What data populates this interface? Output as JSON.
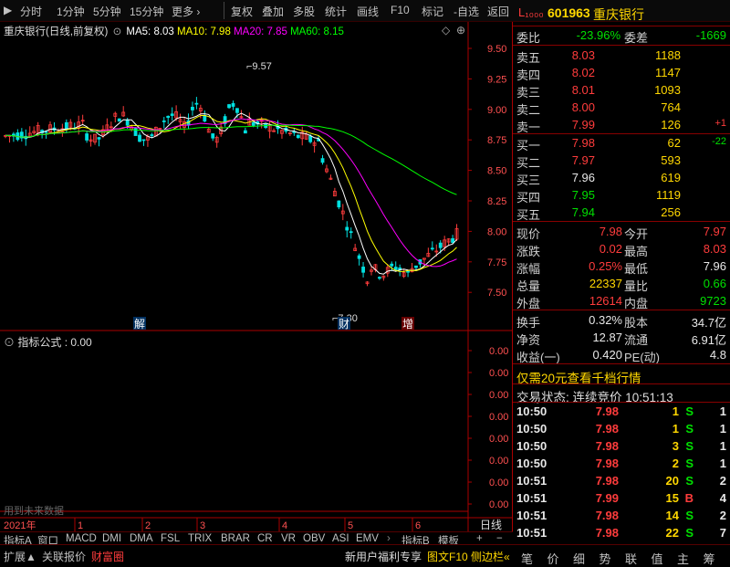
{
  "toolbar": {
    "left": [
      "分时",
      "1分钟",
      "5分钟",
      "15分钟",
      "更多"
    ],
    "right": [
      "复权",
      "叠加",
      "多股",
      "统计",
      "画线",
      "F10",
      "标记",
      "-自选",
      "返回"
    ]
  },
  "legend": {
    "title": "重庆银行(日线,前复权)",
    "ma5": "MA5: 8.03",
    "ma10": "MA10: 7.98",
    "ma20": "MA20: 7.85",
    "ma60": "MA60: 8.15"
  },
  "price_axis": [
    "9.50",
    "9.25",
    "9.00",
    "8.75",
    "8.50",
    "8.25",
    "8.00",
    "7.75",
    "7.50"
  ],
  "annotations": {
    "high": "9.57",
    "low": "7.30",
    "mark1": "解",
    "mark2": "财",
    "mark3": "增"
  },
  "indicator": {
    "title": "指标公式 : 0.00",
    "footer": "用到未来数据",
    "axis": [
      "0.00",
      "0.00",
      "0.00",
      "0.00",
      "0.00",
      "0.00",
      "0.00",
      "0.00"
    ]
  },
  "date_axis": {
    "year": "2021年",
    "months": [
      "1",
      "2",
      "3",
      "4",
      "5",
      "6"
    ],
    "corner": "日线"
  },
  "index_tabs": [
    "指标A",
    "窗口",
    "MACD",
    "DMI",
    "DMA",
    "FSL",
    "TRIX",
    "BRAR",
    "CR",
    "VR",
    "OBV",
    "ASI",
    "EMV"
  ],
  "index_tabs_right": [
    "指标B",
    "模板",
    "+",
    "−"
  ],
  "bottom_tabs": [
    "扩展",
    "关联报价",
    "财富圈"
  ],
  "bottom_right": [
    "新用户福利专享",
    "图文F10",
    "侧边栏"
  ],
  "bottom_mini": [
    "笔",
    "价",
    "细",
    "势",
    "联",
    "值",
    "主",
    "筹"
  ],
  "stock": {
    "code": "601963",
    "name": "重庆银行",
    "l2": "L₁₀₀₀"
  },
  "webi": {
    "l1": "委比",
    "v1": "-23.96%",
    "l2": "委差",
    "v2": "-1669"
  },
  "asks": [
    {
      "label": "卖五",
      "price": "8.03",
      "vol": "1188",
      "chg": ""
    },
    {
      "label": "卖四",
      "price": "8.02",
      "vol": "1147",
      "chg": ""
    },
    {
      "label": "卖三",
      "price": "8.01",
      "vol": "1093",
      "chg": ""
    },
    {
      "label": "卖二",
      "price": "8.00",
      "vol": "764",
      "chg": ""
    },
    {
      "label": "卖一",
      "price": "7.99",
      "vol": "126",
      "chg": "+1"
    }
  ],
  "bids": [
    {
      "label": "买一",
      "price": "7.98",
      "vol": "62",
      "chg": "-22"
    },
    {
      "label": "买二",
      "price": "7.97",
      "vol": "593",
      "chg": ""
    },
    {
      "label": "买三",
      "price": "7.96",
      "vol": "619",
      "chg": ""
    },
    {
      "label": "买四",
      "price": "7.95",
      "vol": "1119",
      "chg": ""
    },
    {
      "label": "买五",
      "price": "7.94",
      "vol": "256",
      "chg": ""
    }
  ],
  "stats": [
    {
      "l1": "现价",
      "v1": "7.98",
      "l2": "今开",
      "v2": "7.97"
    },
    {
      "l1": "涨跌",
      "v1": "0.02",
      "l2": "最高",
      "v2": "8.03"
    },
    {
      "l1": "涨幅",
      "v1": "0.25%",
      "l2": "最低",
      "v2": "7.96"
    },
    {
      "l1": "总量",
      "v1": "22337",
      "l2": "量比",
      "v2": "0.66"
    },
    {
      "l1": "外盘",
      "v1": "12614",
      "l2": "内盘",
      "v2": "9723"
    }
  ],
  "stats2": [
    {
      "l1": "换手",
      "v1": "0.32%",
      "l2": "股本",
      "v2": "34.7亿"
    },
    {
      "l1": "净资",
      "v1": "12.87",
      "l2": "流通",
      "v2": "6.91亿"
    },
    {
      "l1": "收益(一)",
      "v1": "0.420",
      "l2": "PE(动)",
      "v2": "4.8"
    }
  ],
  "promo": "仅需20元查看千档行情",
  "trade_status": "交易状态: 连续竞价 10:51:13",
  "ticks": [
    {
      "t": "10:50",
      "p": "7.98",
      "v": "1",
      "s": "S",
      "n": "1"
    },
    {
      "t": "10:50",
      "p": "7.98",
      "v": "1",
      "s": "S",
      "n": "1"
    },
    {
      "t": "10:50",
      "p": "7.98",
      "v": "3",
      "s": "S",
      "n": "1"
    },
    {
      "t": "10:50",
      "p": "7.98",
      "v": "2",
      "s": "S",
      "n": "1"
    },
    {
      "t": "10:51",
      "p": "7.98",
      "v": "20",
      "s": "S",
      "n": "2"
    },
    {
      "t": "10:51",
      "p": "7.99",
      "v": "15",
      "s": "B",
      "n": "4"
    },
    {
      "t": "10:51",
      "p": "7.98",
      "v": "14",
      "s": "S",
      "n": "2"
    },
    {
      "t": "10:51",
      "p": "7.98",
      "v": "22",
      "s": "S",
      "n": "7"
    }
  ],
  "colors": {
    "up": "#ff3c3c",
    "down": "#00e0e0",
    "ma5": "#ffffff",
    "ma10": "#ffff00",
    "ma20": "#ff00ff",
    "ma60": "#00ff00",
    "grid": "#8b0000"
  }
}
